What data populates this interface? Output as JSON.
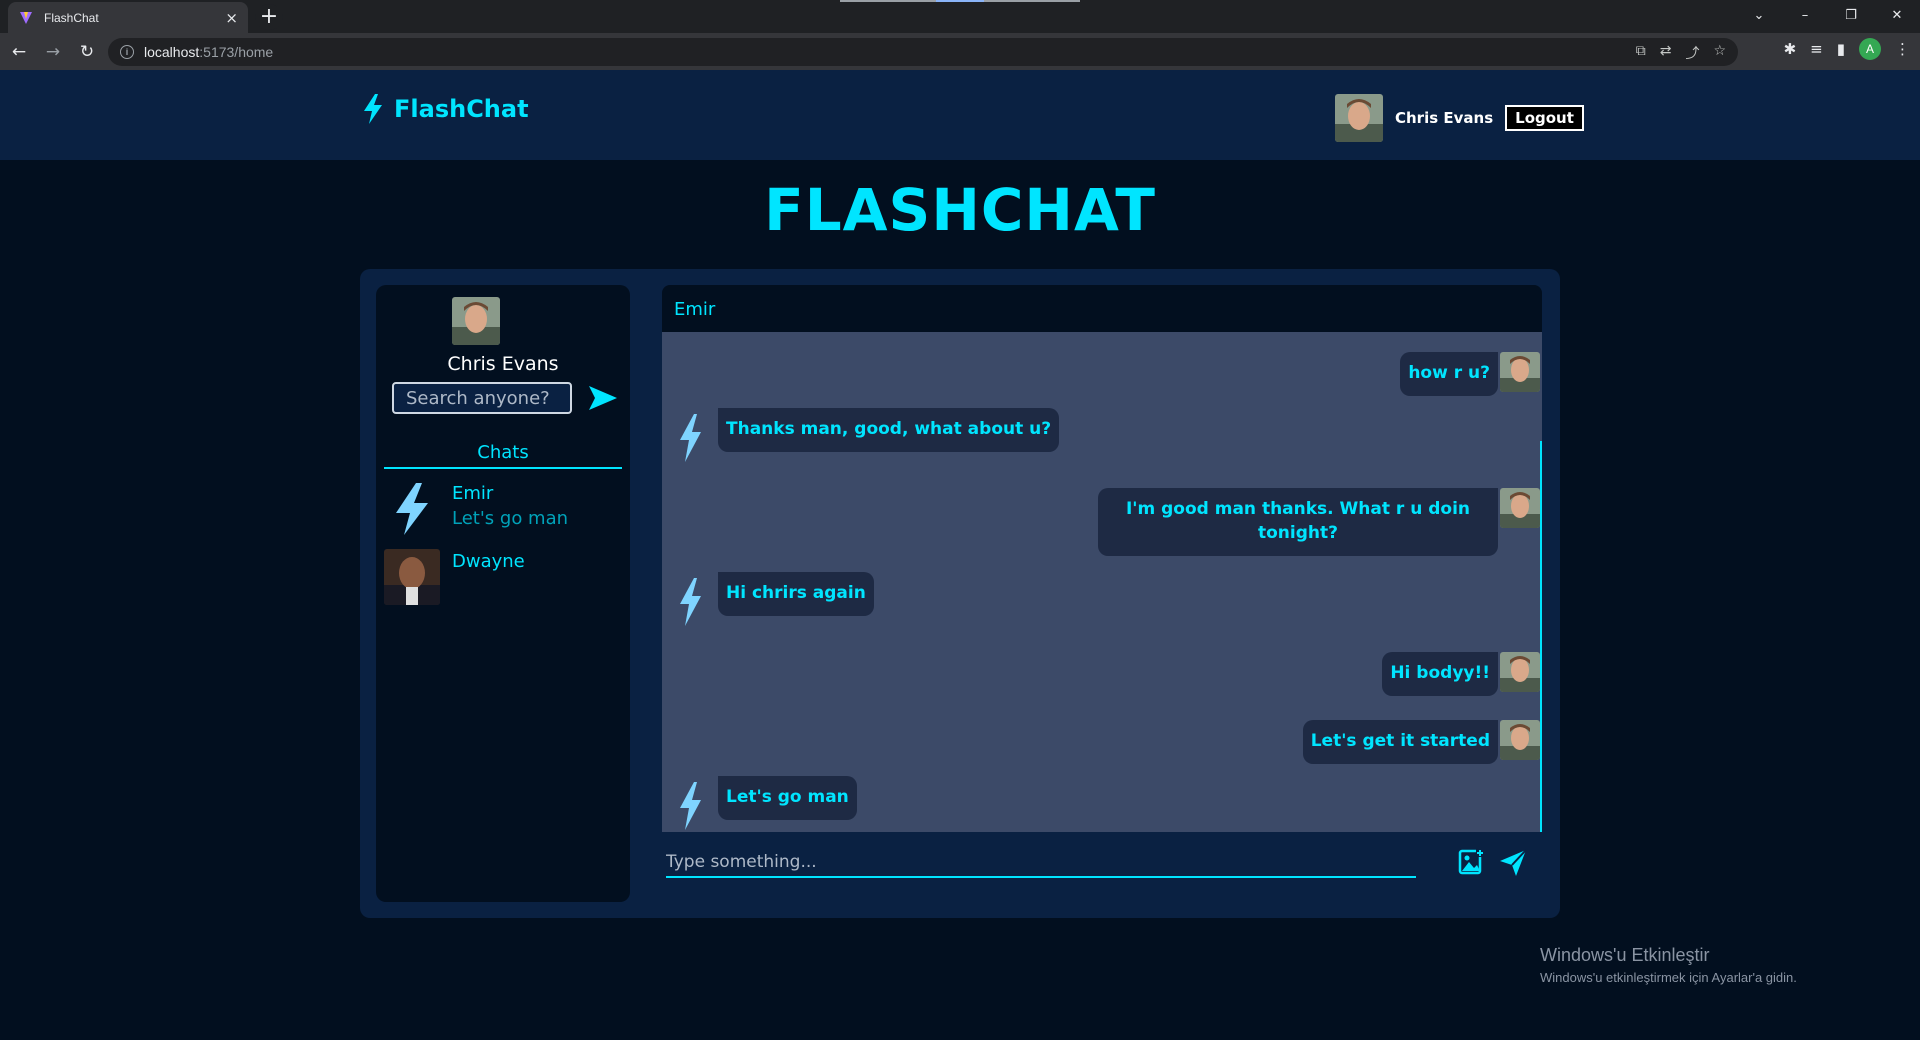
{
  "browser": {
    "tab_title": "FlashChat",
    "tab_close": "×",
    "new_tab": "+",
    "url_host": "localhost",
    "url_rest": ":5173/home",
    "profile_initial": "A"
  },
  "header": {
    "brand": "FlashChat",
    "user_name": "Chris Evans",
    "logout_label": "Logout"
  },
  "page_title": "FLASHCHAT",
  "sidebar": {
    "user_name": "Chris Evans",
    "search_placeholder": "Search anyone?",
    "chats_tab": "Chats",
    "chats": [
      {
        "name": "Emir",
        "last_message": "Let's go man",
        "icon": "lightning-icon"
      },
      {
        "name": "Dwayne",
        "last_message": "",
        "icon": "avatar-photo"
      }
    ]
  },
  "chat": {
    "contact_name": "Emir",
    "messages": [
      {
        "from": "me",
        "text": "how r u?"
      },
      {
        "from": "them",
        "text": "Thanks man, good, what about u?"
      },
      {
        "from": "me",
        "text": "I'm good man thanks. What r u doin tonight?"
      },
      {
        "from": "them",
        "text": "Hi chrirs again"
      },
      {
        "from": "me",
        "text": "Hi bodyy!!"
      },
      {
        "from": "me",
        "text": "Let's get it started"
      },
      {
        "from": "them",
        "text": "Let's go man"
      }
    ],
    "input_placeholder": "Type something..."
  },
  "os_watermark": {
    "line1": "Windows'u Etkinleştir",
    "line2": "Windows'u etkinleştirmek için Ayarlar'a gidin."
  },
  "colors": {
    "accent": "#00e5ff",
    "background": "#020f1f",
    "panel": "#0a2142",
    "messages_bg": "#3c4a68",
    "bubble": "#1e2a44"
  }
}
